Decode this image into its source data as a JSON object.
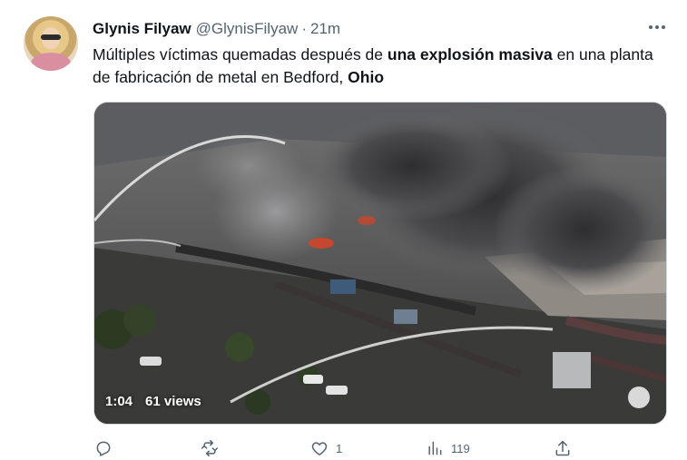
{
  "tweet": {
    "author_name": "Glynis Filyaw",
    "author_handle": "@GlynisFilyaw",
    "separator": "·",
    "time": "21m",
    "text_parts": {
      "p1": "Múltiples víctimas quemadas después de ",
      "b1": "una explosión masiva",
      "p2": " en una planta de fabricación de metal en Bedford, ",
      "b2": "Ohio"
    },
    "video": {
      "duration": "1:04",
      "views": "61 views"
    },
    "actions": {
      "reply_count": "",
      "retweet_count": "",
      "like_count": "1",
      "views_count": "119"
    }
  },
  "icons": {
    "more": "more-horizontal-icon",
    "reply": "reply-icon",
    "retweet": "retweet-icon",
    "like": "heart-icon",
    "views": "bar-chart-icon",
    "share": "share-icon"
  },
  "colors": {
    "text": "#0f1419",
    "secondary": "#536471",
    "border": "#cfd9de"
  }
}
